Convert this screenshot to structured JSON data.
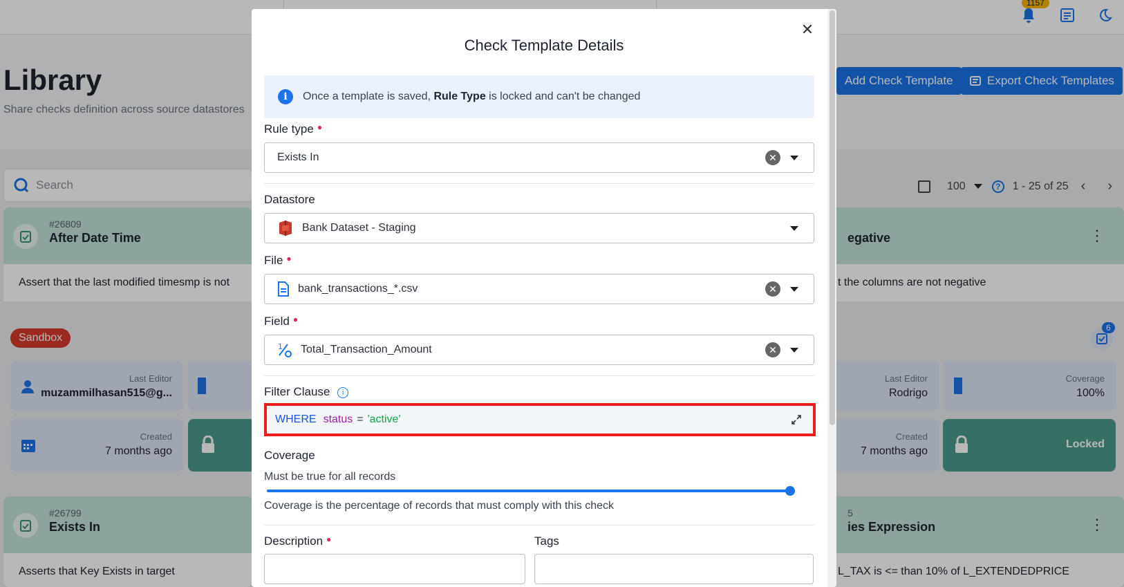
{
  "app": {
    "notification_count": "1157",
    "page_title": "Library",
    "page_subtitle": "Share checks definition across source datastores",
    "add_button": "Add Check Template",
    "export_button": "Export Check Templates",
    "search_placeholder": "Search",
    "page_size": "100",
    "range": "1 - 25 of 25"
  },
  "cards": [
    {
      "id": "#26809",
      "name": "After Date Time",
      "description": "Assert that the last modified timesmp is not",
      "tag": "Sandbox",
      "last_editor_label": "Last Editor",
      "last_editor": "muzammilhasan515@g...",
      "created_label": "Created",
      "created": "7 months ago"
    },
    {
      "name_fragment": "egative",
      "description_fragment": "t the columns are not negative",
      "badge_count": "6",
      "last_editor_label": "Last Editor",
      "last_editor": "Rodrigo",
      "coverage_label": "Coverage",
      "coverage": "100%",
      "created_label": "Created",
      "created": "7 months ago",
      "locked_label": "Locked"
    },
    {
      "id": "#26799",
      "name": "Exists In",
      "description": "Asserts that Key Exists in target"
    },
    {
      "id_fragment": "5",
      "name_fragment": "ies Expression",
      "description_fragment": "L_TAX is <= than 10% of L_EXTENDEDPRICE"
    }
  ],
  "modal": {
    "title": "Check Template Details",
    "info_prefix": "Once a template is saved,",
    "info_bold": "Rule Type",
    "info_suffix": "is locked and can't be changed",
    "rule_type_label": "Rule type",
    "rule_type_value": "Exists In",
    "datastore_label": "Datastore",
    "datastore_value": "Bank Dataset - Staging",
    "file_label": "File",
    "file_value": "bank_transactions_*.csv",
    "field_label": "Field",
    "field_value": "Total_Transaction_Amount",
    "filter_label": "Filter Clause",
    "filter": {
      "keyword": "WHERE",
      "field": "status",
      "operator": "=",
      "value": "'active'"
    },
    "coverage_label": "Coverage",
    "coverage_desc": "Must be true for all records",
    "coverage_value": 1.0,
    "coverage_hint": "Coverage is the percentage of records that must comply with this check",
    "description_label": "Description",
    "tags_label": "Tags"
  },
  "colors": {
    "primary": "#1a73e8",
    "required": "#e0245e",
    "highlight": "#ee1c1c",
    "sandbox": "#d93a2b",
    "card_header": "#c4e2dc"
  }
}
